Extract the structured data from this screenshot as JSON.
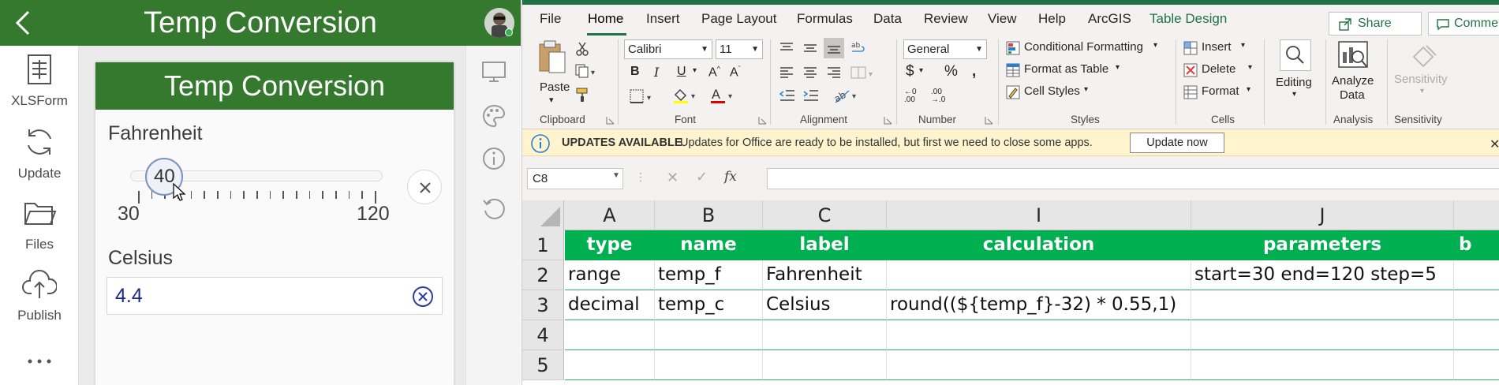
{
  "survey123": {
    "app_title": "Temp Conversion",
    "sidebar": {
      "items": [
        {
          "label": "XLSForm",
          "icon": "xlsform-icon"
        },
        {
          "label": "Update",
          "icon": "update-icon"
        },
        {
          "label": "Files",
          "icon": "folder-icon"
        },
        {
          "label": "Publish",
          "icon": "publish-icon"
        }
      ],
      "more": "•••"
    },
    "form": {
      "header": "Temp Conversion",
      "fahrenheit": {
        "label": "Fahrenheit",
        "value": "40",
        "min": "30",
        "max": "120",
        "value_num": 40,
        "min_num": 30,
        "max_num": 120,
        "step_num": 5
      },
      "celsius": {
        "label": "Celsius",
        "value": "4.4"
      }
    },
    "rail": [
      "desktop-icon",
      "palette-icon",
      "info-icon",
      "refresh-icon"
    ],
    "colors": {
      "brand": "#35792e"
    }
  },
  "excel": {
    "tabs": [
      "File",
      "Home",
      "Insert",
      "Page Layout",
      "Formulas",
      "Data",
      "Review",
      "View",
      "Help",
      "ArcGIS",
      "Table Design"
    ],
    "active_tab": "Home",
    "share": "Share",
    "comments": "Comments",
    "ribbon": {
      "clipboard": {
        "label": "Clipboard",
        "paste": "Paste"
      },
      "font": {
        "label": "Font",
        "name": "Calibri",
        "size": "11"
      },
      "alignment": {
        "label": "Alignment"
      },
      "number": {
        "label": "Number",
        "format": "General"
      },
      "styles": {
        "label": "Styles",
        "conditional": "Conditional Formatting",
        "format_table": "Format as Table",
        "cell_styles": "Cell Styles"
      },
      "cells": {
        "label": "Cells",
        "insert": "Insert",
        "delete": "Delete",
        "format": "Format"
      },
      "editing": {
        "label": "Editing"
      },
      "analysis": {
        "label": "Analysis",
        "analyze_line1": "Analyze",
        "analyze_line2": "Data"
      },
      "sensitivity": {
        "label": "Sensitivity",
        "button": "Sensitivity"
      }
    },
    "message": {
      "title": "UPDATES AVAILABLE",
      "text": "Updates for Office are ready to be installed, but first we need to close some apps.",
      "button": "Update now"
    },
    "name_box": "C8",
    "grid": {
      "columns": [
        "A",
        "B",
        "C",
        "I",
        "J"
      ],
      "rows": [
        "1",
        "2",
        "3",
        "4",
        "5"
      ],
      "cells": [
        [
          "type",
          "name",
          "label",
          "calculation",
          "parameters",
          "b"
        ],
        [
          "range",
          "temp_f",
          "Fahrenheit",
          "",
          "start=30 end=120 step=5",
          ""
        ],
        [
          "decimal",
          "temp_c",
          "Celsius",
          "round((${temp_f}-32) * 0.55,1)",
          "",
          ""
        ],
        [
          "",
          "",
          "",
          "",
          "",
          ""
        ],
        [
          "",
          "",
          "",
          "",
          "",
          ""
        ]
      ]
    },
    "colors": {
      "accent": "#217346",
      "table_header": "#00b050"
    }
  }
}
